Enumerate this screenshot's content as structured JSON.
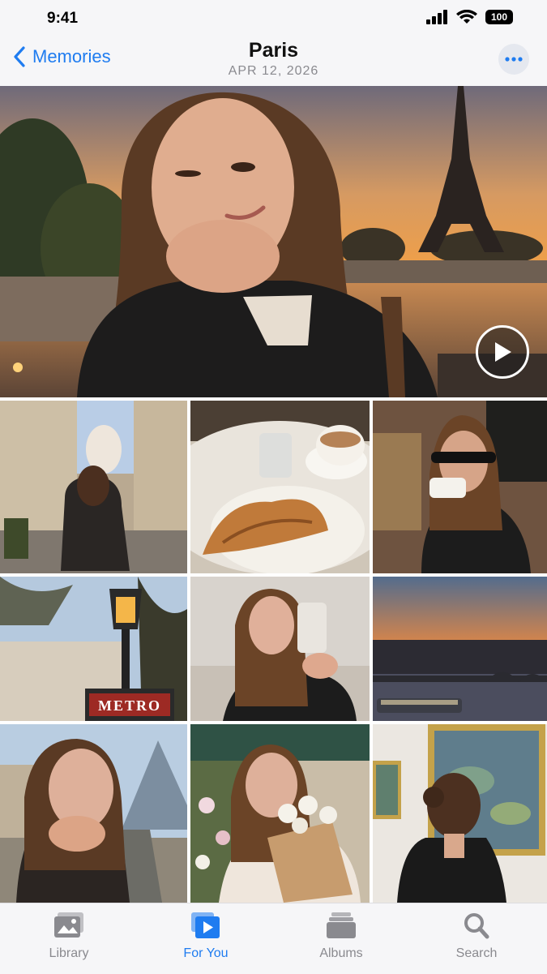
{
  "status_bar": {
    "time": "9:41",
    "battery": "100"
  },
  "nav": {
    "back_label": "Memories",
    "title": "Paris",
    "date": "APR 12, 2026"
  },
  "hero": {
    "description_icon": "play-icon"
  },
  "grid": [
    "street-photo",
    "croissant-photo",
    "cafe-photo",
    "lamp-metro-photo",
    "selfie-photo",
    "sunset-bridge-photo",
    "louvre-photo",
    "flowers-photo",
    "museum-photo"
  ],
  "tabs": [
    {
      "label": "Library",
      "active": false
    },
    {
      "label": "For You",
      "active": true
    },
    {
      "label": "Albums",
      "active": false
    },
    {
      "label": "Search",
      "active": false
    }
  ],
  "colors": {
    "accent": "#1f7cf0",
    "inactive": "#8a8a8f"
  }
}
